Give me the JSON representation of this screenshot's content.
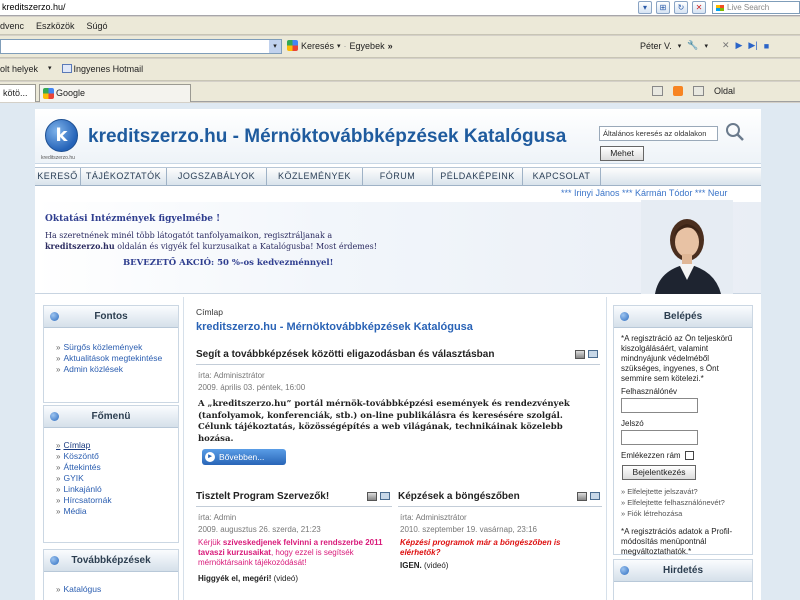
{
  "browser": {
    "url": "kreditszerzo.hu/",
    "live_search_placeholder": "Live Search",
    "menu": [
      "dvenc",
      "Eszközök",
      "Súgó"
    ],
    "search_label": "Keresés",
    "extras_label": "Egyebek",
    "user_label": "Péter V.",
    "favorites": [
      "olt helyek",
      "Ingyenes Hotmail"
    ],
    "tabs": [
      "kötö...",
      "Google"
    ],
    "page_menu": "Oldal"
  },
  "site": {
    "logo_letter": "k",
    "logo_caption": "kreditszerzo.hu",
    "title": "kreditszerzo.hu - Mérnöktovábbképzések Katalógusa",
    "search_placeholder": "Általános keresés az oldalakon",
    "search_button": "Mehet",
    "nav": [
      "KERESŐ",
      "TÁJÉKOZTATÓK",
      "JOGSZABÁLYOK",
      "KÖZLEMÉNYEK",
      "FÓRUM",
      "PÉLDAKÉPEINK",
      "KAPCSOLAT"
    ],
    "ticker": "*** Irinyi János *** Kármán Tódor *** Neur"
  },
  "banner": {
    "title": "Oktatási Intézmények figyelmébe !",
    "text_prefix": "Ha szeretnének minél több látogatót tanfolyamaikon, regisztráljanak a",
    "text_bold": "kreditszerzo.hu",
    "text_suffix": "oldalán és vigyék fel kurzusaikat a Katalógusba! Most érdemes!",
    "offer": "BEVEZETŐ AKCIÓ: 50 %-os kedvezménnyel!"
  },
  "left": {
    "fontos": {
      "title": "Fontos",
      "links": [
        "Sürgős közlemények",
        "Aktualitások megtekintése",
        "Admin közlések"
      ]
    },
    "fomenu": {
      "title": "Főmenü",
      "links": [
        "Címlap",
        "Köszöntő",
        "Áttekintés",
        "GYIK",
        "Linkajánló",
        "Hírcsatornák",
        "Média"
      ]
    },
    "tovabb": {
      "title": "Továbbképzések",
      "links": [
        "Katalógus"
      ]
    }
  },
  "center": {
    "breadcrumb": "Címlap",
    "title": "kreditszerzo.hu - Mérnöktovábbképzések Katalógusa",
    "article1": {
      "title": "Segít a továbbképzések közötti eligazodásban és választásban",
      "author": "írta: Adminisztrátor",
      "date": "2009. április 03. péntek, 16:00",
      "body": "A „kreditszerzo.hu” portál mérnök-továbbképzési események és rendezvények (tanfolyamok, konferenciák, stb.) on-line publikálásra és keresésére szolgál. Célunk tájékoztatás, közösségépítés a web világának, technikáinak közelebb hozása.",
      "more": "Bővebben..."
    },
    "article2": {
      "title": "Tisztelt Program Szervezők!",
      "author": "írta: Admin",
      "date": "2009. augusztus 26. szerda, 21:23",
      "lead_plain": "Kérjük",
      "lead_bold": "szíveskedjenek felvinni a rendszerbe 2011 tavaszi kurzusaikat",
      "lead_rest": ", hogy ezzel is segítsék mérnöktársaink tájékozódását!",
      "footer_bold": "Higgyék el, megéri!",
      "footer_plain": "(videó)"
    },
    "article3": {
      "title": "Képzések a böngészőben",
      "author": "írta: Adminisztrátor",
      "date": "2010. szeptember 19. vasárnap, 23:16",
      "lead": "Képzési programok már a böngészőben is elérhetők?",
      "footer_bold": "IGEN.",
      "footer_plain": "(videó)"
    }
  },
  "right": {
    "login": {
      "title": "Belépés",
      "intro": "*A regisztráció az Ön teljeskörű kiszolgálásáért, valamint mindnyájunk védelméből szükséges, ingyenes, s Önt semmire sem kötelezi.*",
      "username_label": "Felhasználónév",
      "password_label": "Jelszó",
      "remember_label": "Emlékezzen rám",
      "button": "Bejelentkezés",
      "links": [
        "Elfelejtette jelszavát?",
        "Elfelejtette felhasználónevét?",
        "Fiók létrehozása"
      ],
      "note": "*A regisztrációs adatok a Profil-módosítás menüpontnál megváltoztathatók.*"
    },
    "ads": {
      "title": "Hirdetés"
    }
  }
}
